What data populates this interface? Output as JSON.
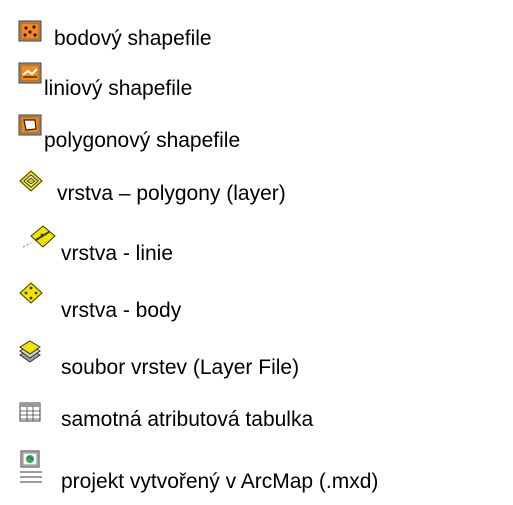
{
  "legend": {
    "items": [
      {
        "icon": "point-shapefile-icon",
        "label": "bodový shapefile"
      },
      {
        "icon": "line-shapefile-icon",
        "label": "liniový shapefile"
      },
      {
        "icon": "polygon-shapefile-icon",
        "label": "polygonový shapefile"
      },
      {
        "icon": "polygon-layer-icon",
        "label": "vrstva – polygony (layer)"
      },
      {
        "icon": "line-layer-icon",
        "label": "vrstva - linie"
      },
      {
        "icon": "point-layer-icon",
        "label": "vrstva - body"
      },
      {
        "icon": "layer-file-icon",
        "label": "soubor vrstev (Layer File)"
      },
      {
        "icon": "attribute-table-icon",
        "label": "samotná atributová tabulka"
      },
      {
        "icon": "arcmap-project-icon",
        "label": "projekt vytvořený v ArcMap (.mxd)"
      }
    ]
  }
}
